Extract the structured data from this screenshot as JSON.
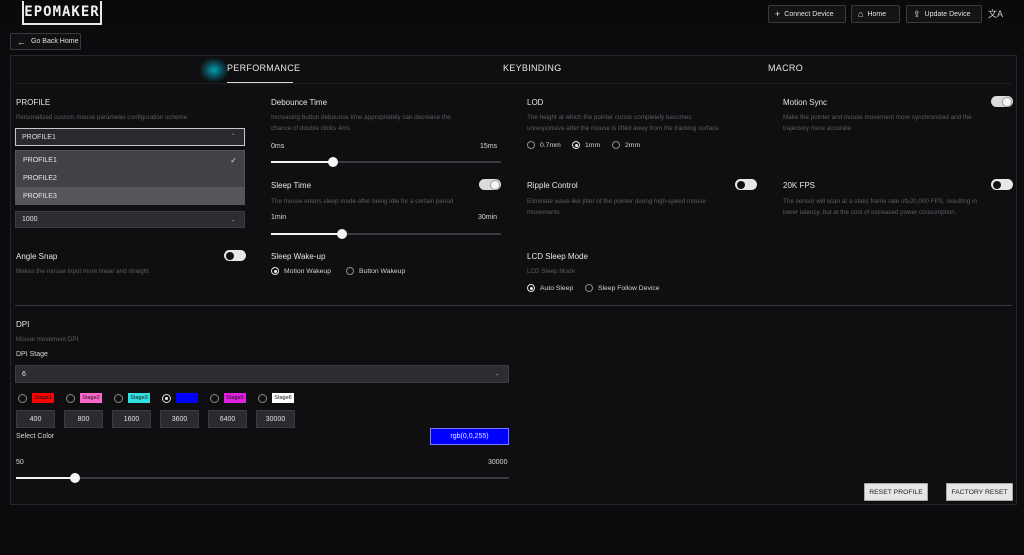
{
  "header": {
    "logo_text": "EPOMAKER",
    "connect_label": "Connect Device",
    "home_label": "Home",
    "update_label": "Update Device",
    "translate_glyph": "文A"
  },
  "back_label": "Go Back Home",
  "tabs": [
    {
      "label": "PERFORMANCE",
      "active": true
    },
    {
      "label": "KEYBINDING",
      "active": false
    },
    {
      "label": "MACRO",
      "active": false
    }
  ],
  "profile": {
    "title": "PROFILE",
    "desc": "Personalized custom mouse parameter configuration scheme",
    "selected": "PROFILE1",
    "options": [
      "PROFILE1",
      "PROFILE2",
      "PROFILE3"
    ],
    "check": "✓"
  },
  "polling": {
    "selected": "1000"
  },
  "angle_snap": {
    "title": "Angle Snap",
    "desc": "Makes the mouse input more linear and straight",
    "on": false
  },
  "debounce": {
    "title": "Debounce Time",
    "desc_line1": "Increasing button debounce time appropriately can decrease the",
    "desc_line2": "chance of double clicks 4ms",
    "min_label": "0ms",
    "max_label": "15ms",
    "value_fraction": 0.27
  },
  "sleep_time": {
    "title": "Sleep Time",
    "desc": "The mouse enters sleep mode after being idle for a certain period",
    "min_label": "1min",
    "max_label": "30min",
    "value_fraction": 0.31,
    "on": true
  },
  "sleep_wakeup": {
    "title": "Sleep Wake-up",
    "options": [
      "Motion Wakeup",
      "Button Wakeup"
    ],
    "selected": 0
  },
  "lod": {
    "title": "LOD",
    "desc_line1": "The height at which the pointer cursor completely becomes",
    "desc_line2": "unresponsive after the mouse is lifted away from the tracking surface",
    "options": [
      "0.7mm",
      "1mm",
      "2mm"
    ],
    "selected": 1
  },
  "ripple": {
    "title": "Ripple Control",
    "desc_line1": "Eliminate wave-like jitter of the pointer during high-speed mouse",
    "desc_line2": "movements",
    "on": false
  },
  "lcd_sleep": {
    "title": "LCD Sleep Mode",
    "desc": "LCD Sleep Mode",
    "options": [
      "Auto Sleep",
      "Sleep Follow Device"
    ],
    "selected": 0
  },
  "motion_sync": {
    "title": "Motion Sync",
    "desc_line1": "Make the pointer and mouse movement more synchronized and the",
    "desc_line2": "trajectory more accurate",
    "on": true
  },
  "fps20k": {
    "title": "20K FPS",
    "desc_line1": "The sensor will scan at a static frame rate of≥20,000 FPS, resulting in",
    "desc_line2": "lower latency, but at the cost of increased power consumption.",
    "on": false
  },
  "dpi": {
    "title": "DPI",
    "desc": "Mouse movement DPI",
    "stage_label": "DPI Stage",
    "stage_count": "6",
    "stages": [
      {
        "label": "Stage1",
        "color": "#ff0000",
        "text_color": "#111111",
        "value": "400"
      },
      {
        "label": "Stage2",
        "color": "#ff66cc",
        "text_color": "#111111",
        "value": "800"
      },
      {
        "label": "Stage3",
        "color": "#33e0e0",
        "text_color": "#111111",
        "value": "1600"
      },
      {
        "label": "Stage4",
        "color": "#0000ff",
        "text_color": "#0000ff",
        "value": "3600"
      },
      {
        "label": "Stage5",
        "color": "#e020e0",
        "text_color": "#111111",
        "value": "6400"
      },
      {
        "label": "Stage6",
        "color": "#ffffff",
        "text_color": "#111111",
        "value": "30000"
      }
    ],
    "selected_stage": 3,
    "select_color_label": "Select Color",
    "color_value": "rgb(0,0,255)",
    "min_label": "50",
    "max_label": "30000",
    "value_fraction": 0.12
  },
  "actions": {
    "reset_profile": "RESET PROFILE",
    "factory_reset": "FACTORY RESET"
  }
}
